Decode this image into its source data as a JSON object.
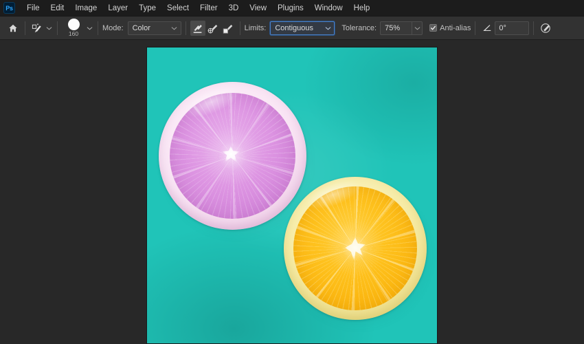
{
  "app": {
    "name": "Adobe Photoshop",
    "logo_text": "Ps"
  },
  "menubar": {
    "items": [
      {
        "label": "File"
      },
      {
        "label": "Edit"
      },
      {
        "label": "Image"
      },
      {
        "label": "Layer"
      },
      {
        "label": "Type"
      },
      {
        "label": "Select"
      },
      {
        "label": "Filter"
      },
      {
        "label": "3D"
      },
      {
        "label": "View"
      },
      {
        "label": "Plugins"
      },
      {
        "label": "Window"
      },
      {
        "label": "Help"
      }
    ]
  },
  "options_bar": {
    "home_icon": "home-icon",
    "tool_preset_icon": "brush-preset-icon",
    "brush": {
      "size_label": "160",
      "preview_icon": "brush-tip-circle-icon"
    },
    "mode": {
      "label": "Mode:",
      "value": "Color"
    },
    "sampling": {
      "continuous_icon": "sample-continuous-icon",
      "once_icon": "sample-once-icon",
      "background_swatch_icon": "sample-background-swatch-icon",
      "active": "continuous"
    },
    "limits": {
      "label": "Limits:",
      "value": "Contiguous",
      "focused": true
    },
    "tolerance": {
      "label": "Tolerance:",
      "value": "75%"
    },
    "antialias": {
      "label": "Anti-alias",
      "checked": true
    },
    "angle": {
      "icon": "angle-protractor-icon",
      "value": "0°"
    },
    "pressure_toggle_icon": "pressure-size-toggle-icon"
  },
  "canvas": {
    "document_name": "",
    "background_color": "#20c4b8",
    "pink_slice": {
      "flesh_color": "#dd95e2",
      "rind_color": "#f7dff2",
      "core_color": "#ffffff"
    },
    "orange_slice": {
      "flesh_color": "#fcb913",
      "rind_color": "#f6eba4",
      "core_color": "#fffdf2"
    }
  },
  "colors": {
    "menubar_bg": "#1c1c1c",
    "options_bar_bg": "#323232",
    "workspace_bg": "#282828",
    "accent_blue": "#31a8ff",
    "focus_blue": "#4a7fc4"
  }
}
